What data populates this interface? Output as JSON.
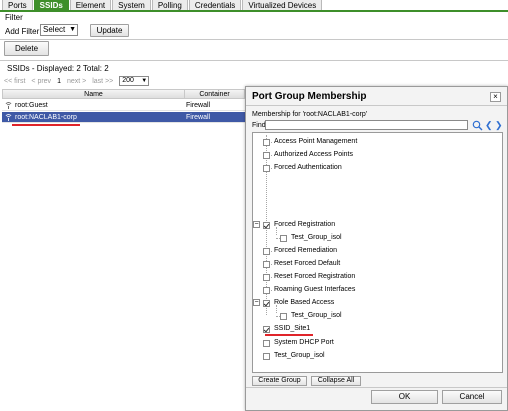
{
  "tabs": [
    "Ports",
    "SSIDs",
    "Element",
    "System",
    "Polling",
    "Credentials",
    "Virtualized Devices"
  ],
  "active_tab": "SSIDs",
  "filter": {
    "title": "Filter",
    "add_filter_label": "Add Filter:",
    "select_value": "Select",
    "update_label": "Update"
  },
  "toolbar": {
    "delete_label": "Delete"
  },
  "summary": "SSIDs - Displayed: 2 Total: 2",
  "pager": {
    "first": "<< first",
    "prev": "< prev",
    "page": "1",
    "next": "next >",
    "last": "last >>",
    "page_size": "200"
  },
  "grid": {
    "columns": [
      "Name",
      "Container"
    ],
    "rows": [
      {
        "name": "root:Guest",
        "container": "Firewall",
        "selected": false
      },
      {
        "name": "root:NACLAB1-corp",
        "container": "Firewall",
        "selected": true
      }
    ]
  },
  "dialog": {
    "title": "Port Group Membership",
    "close": "×",
    "membership_for": "Membership for 'root:NACLAB1-corp'",
    "find_label": "Find:",
    "items": [
      {
        "label": "Access Point Management",
        "checked": false,
        "level": 0
      },
      {
        "label": "Authorized Access Points",
        "checked": false,
        "level": 0
      },
      {
        "label": "Forced Authentication",
        "checked": false,
        "level": 0
      },
      {
        "label": "Forced Registration",
        "checked": true,
        "level": 0,
        "expanded": true
      },
      {
        "label": "Test_Group_isol",
        "checked": false,
        "level": 1
      },
      {
        "label": "Forced Remediation",
        "checked": false,
        "level": 0
      },
      {
        "label": "Reset Forced Default",
        "checked": false,
        "level": 0
      },
      {
        "label": "Reset Forced Registration",
        "checked": false,
        "level": 0
      },
      {
        "label": "Roaming Guest Interfaces",
        "checked": false,
        "level": 0
      },
      {
        "label": "Role Based Access",
        "checked": true,
        "level": 0,
        "expanded": true
      },
      {
        "label": "Test_Group_isol",
        "checked": false,
        "level": 1
      },
      {
        "label": "SSID_Site1",
        "checked": true,
        "level": 0
      },
      {
        "label": "System DHCP Port",
        "checked": false,
        "level": 0
      },
      {
        "label": "Test_Group_isol",
        "checked": false,
        "level": 0
      }
    ],
    "create_group_label": "Create Group",
    "collapse_all_label": "Collapse All",
    "ok_label": "OK",
    "cancel_label": "Cancel"
  },
  "colors": {
    "tab_active": "#3e8f2a",
    "row_selected": "#3f59a6",
    "highlight": "#e0242a",
    "nav_arrows": "#2f6fd1"
  }
}
